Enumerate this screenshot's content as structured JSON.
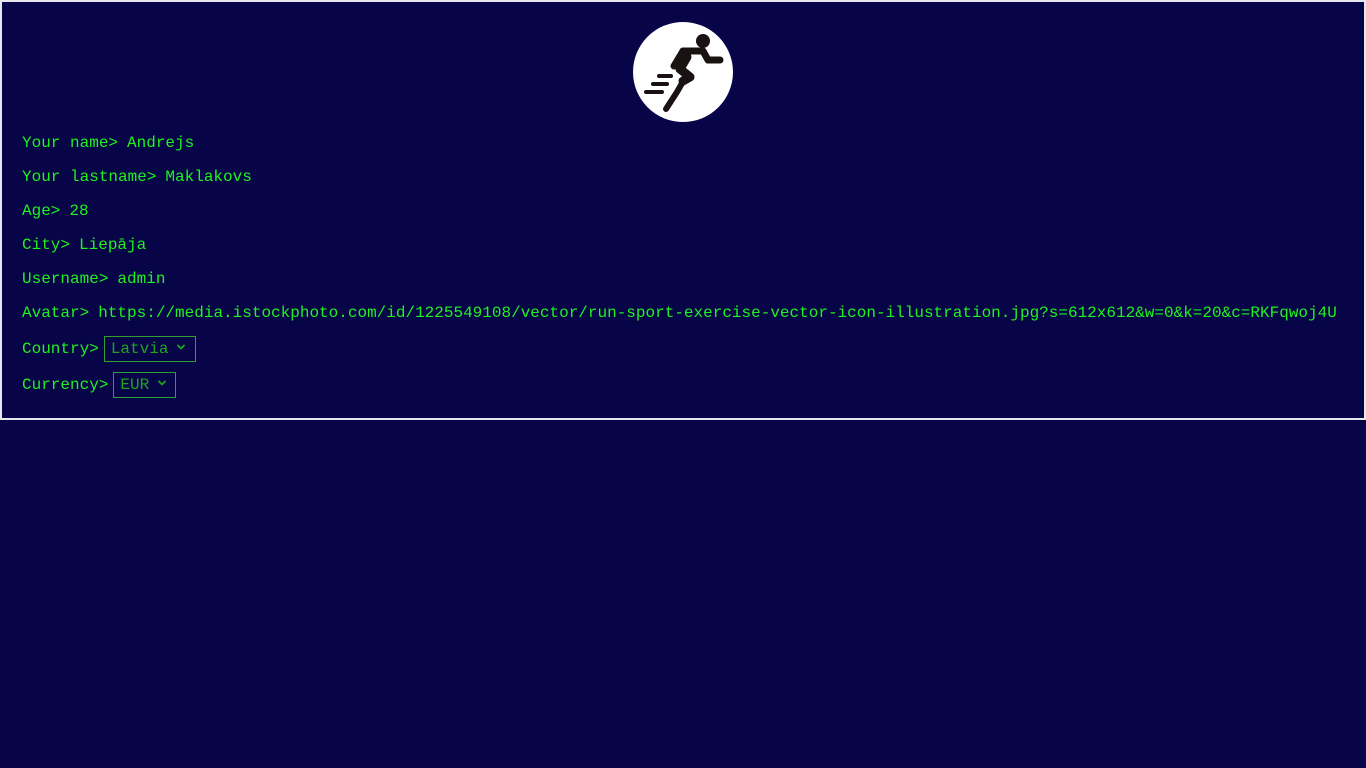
{
  "theme": {
    "background": "#070548",
    "text": "#1ff21f",
    "select_text": "#1ea51e",
    "select_border": "#2fa02f",
    "panel_border": "#e6e6ee",
    "avatar_bg": "#ffffff",
    "avatar_figure": "#1a1212"
  },
  "avatar": {
    "icon": "running-person-icon"
  },
  "profile": {
    "name": {
      "label": "Your name>",
      "value": "Andrejs"
    },
    "lastname": {
      "label": "Your lastname>",
      "value": "Maklakovs"
    },
    "age": {
      "label": "Age>",
      "value": "28"
    },
    "city": {
      "label": "City>",
      "value": "Liepāja"
    },
    "username": {
      "label": "Username>",
      "value": "admin"
    },
    "avatar_url": {
      "label": "Avatar>",
      "value": "https://media.istockphoto.com/id/1225549108/vector/run-sport-exercise-vector-icon-illustration.jpg?s=612x612&w=0&k=20&c=RKFqwoj4U"
    },
    "country": {
      "label": "Country>",
      "selected": "Latvia"
    },
    "currency": {
      "label": "Currency>",
      "selected": "EUR"
    }
  }
}
